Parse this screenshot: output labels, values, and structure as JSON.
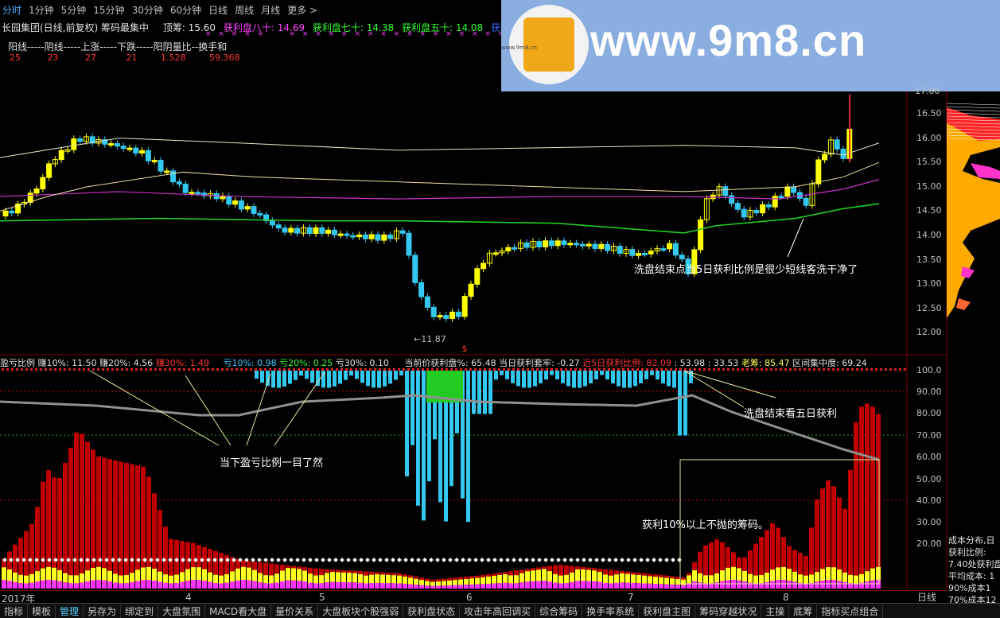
{
  "topbar": {
    "tabs": [
      "分时",
      "1分钟",
      "5分钟",
      "15分钟",
      "30分钟",
      "60分钟",
      "日线",
      "周线",
      "月线",
      "更多 >"
    ],
    "active_index": 0
  },
  "watermark": {
    "text": "www.9m8.cn",
    "sub": "www.9m8.cn"
  },
  "header": {
    "title": "长园集团(日线,前复权) 筹码最集中",
    "top_chip": "顶筹: 15.60",
    "profit80": "获利盘八十: 14.69",
    "profit70": "获利盘七十: 14.38",
    "profit50": "获利盘五十: 14.08",
    "profit_more": "获利盘"
  },
  "stats": {
    "labels": "阳线-----阴线-----上涨-----下跌-----阳阴量比--换手和",
    "values": [
      "25",
      "23",
      "27",
      "21",
      "1.528",
      "59.368"
    ]
  },
  "price_axis": [
    "16.50",
    "16.00",
    "15.50",
    "15.00",
    "14.50",
    "14.00",
    "13.50",
    "13.00",
    "12.50",
    "12.00"
  ],
  "price_top_tick": "17.00",
  "min_label": "←11.87",
  "lower_header": {
    "name": "盈亏比例",
    "e10": "赚10%: 11.50",
    "e20": "赚20%: 4.56",
    "e30": "赚30%: 1.49",
    "l10": "亏10%: 0.98",
    "l20": "亏20%: 0.25",
    "l30": "亏30%: 0.10",
    "cur_profit": "当前价获利盘%: 65.48",
    "day_trap": "当日获利套牢: -0.27",
    "five_day": "近5日获利比例: 82.09",
    "v1": ": 53.98",
    "v2": ": 33.53",
    "old_chip": "老筹: 85.47",
    "concentration": "区间集中度: 69.24"
  },
  "pct_axis": [
    "100.0",
    "90.00",
    "80.00",
    "70.00",
    "60.00",
    "50.00",
    "40.00",
    "30.00",
    "20.00"
  ],
  "annotations": {
    "a1": "洗盘结束点当5日获利比例是很少短线客洗干净了",
    "a2": "洗盘结束看五日获利",
    "a3": "当下盈亏比例一目了然",
    "a4": "获利10%以上不抛的筹码。"
  },
  "x_labels": [
    "2017年",
    "4",
    "5",
    "6",
    "7",
    "8"
  ],
  "x_unit": "日线",
  "chip_info": [
    "成本分布,日",
    "获利比例:",
    "7.40处获利盘",
    "平均成本: 1",
    "90%成本1",
    "70%成本12"
  ],
  "bottom_tabs": [
    "指标",
    "模板",
    "管理",
    "另存为",
    "绑定到",
    "大盘氛围",
    "MACD看大盘",
    "量价关系",
    "大盘板块个股强弱",
    "获利盘状态",
    "攻击年高回调买",
    "综合筹码",
    "换手率系统",
    "获利盘主图",
    "筹码穿越状况",
    "主操",
    "底筹",
    "指标买点组合"
  ],
  "bottom_active": 2,
  "colors": {
    "up": "#ffff00",
    "down": "#33c8f0",
    "ma_green": "#22cc22",
    "ma_purple": "#cc33cc",
    "ma_white": "#e8e8c8",
    "bar_red": "#c00000",
    "grid_red": "#c00000"
  }
}
